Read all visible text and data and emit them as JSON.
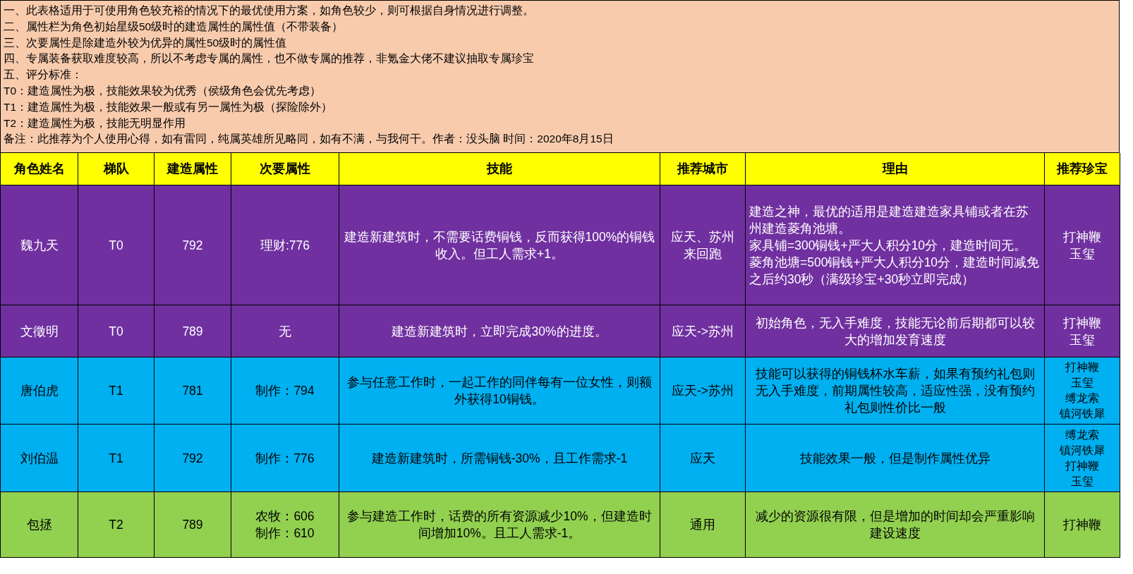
{
  "notes": [
    "一、此表格适用于可使用角色较充裕的情况下的最优使用方案，如角色较少，则可根据自身情况进行调整。",
    "二、属性栏为角色初始星级50级时的建造属性的属性值（不带装备）",
    "三、次要属性是除建造外较为优异的属性50级时的属性值",
    "四、专属装备获取难度较高，所以不考虑专属的属性，也不做专属的推荐，非氪金大佬不建议抽取专属珍宝",
    "五、评分标准：",
    "T0：建造属性为极，技能效果较为优秀（侯级角色会优先考虑）",
    "T1：建造属性为极，技能效果一般或有另一属性为极（探险除外）",
    "T2：建造属性为极，技能无明显作用",
    "备注：此推荐为个人使用心得，如有雷同，纯属英雄所见略同，如有不满，与我何干。作者：没头脑  时间：2020年8月15日"
  ],
  "table": {
    "columns": [
      "角色姓名",
      "梯队",
      "建造属性",
      "次要属性",
      "技能",
      "推荐城市",
      "理由",
      "推荐珍宝"
    ],
    "rows": [
      {
        "color": "#7030a0",
        "name": "魏九天",
        "tier": "T0",
        "build": "792",
        "secondary": [
          "理财:776"
        ],
        "skill": "建造新建筑时，不需要话费铜钱，反而获得100%的铜钱收入。但工人需求+1。",
        "city": [
          "应天、苏州",
          "来回跑"
        ],
        "reason": [
          "建造之神，最优的适用是建造建造家具铺或者在苏州建造菱角池塘。",
          "家具铺=300铜钱+严大人积分10分，建造时间无。",
          "菱角池塘=500铜钱+严大人积分10分，建造时间减免之后约30秒（满级珍宝+30秒立即完成）"
        ],
        "treasures": [
          "打神鞭",
          "玉玺"
        ]
      },
      {
        "color": "#7030a0",
        "name": "文徵明",
        "tier": "T0",
        "build": "789",
        "secondary": [
          "无"
        ],
        "skill": "建造新建筑时，立即完成30%的进度。",
        "city": [
          "应天->苏州"
        ],
        "reason": [
          "初始角色，无入手难度，技能无论前后期都可以较大的增加发育速度"
        ],
        "treasures": [
          "打神鞭",
          "玉玺"
        ]
      },
      {
        "color": "#00b0f0",
        "name": "唐伯虎",
        "tier": "T1",
        "build": "781",
        "secondary": [
          "制作：794"
        ],
        "skill": "参与任意工作时，一起工作的同伴每有一位女性，则额外获得10铜钱。",
        "city": [
          "应天->苏州"
        ],
        "reason": [
          "技能可以获得的铜钱杯水车薪，如果有预约礼包则无入手难度，前期属性较高，适应性强，没有预约礼包则性价比一般"
        ],
        "treasures": [
          "打神鞭",
          "玉玺",
          "缚龙索",
          "镇河铁犀"
        ]
      },
      {
        "color": "#00b0f0",
        "name": "刘伯温",
        "tier": "T1",
        "build": "792",
        "secondary": [
          "制作：776"
        ],
        "skill": "建造新建筑时，所需铜钱-30%，且工作需求-1",
        "city": [
          "应天"
        ],
        "reason": [
          "技能效果一般，但是制作属性优异"
        ],
        "treasures": [
          "缚龙索",
          "镇河铁犀",
          "打神鞭",
          "玉玺"
        ]
      },
      {
        "color": "#92d050",
        "name": "包拯",
        "tier": "T2",
        "build": "789",
        "secondary": [
          "农牧：606",
          "制作：610"
        ],
        "skill": "参与建造工作时，话费的所有资源减少10%，但建造时间增加10%。且工人需求-1。",
        "city": [
          "通用"
        ],
        "reason": [
          "减少的资源很有限，但是增加的时间却会严重影响建设速度"
        ],
        "treasures": [
          "打神鞭"
        ]
      }
    ]
  }
}
